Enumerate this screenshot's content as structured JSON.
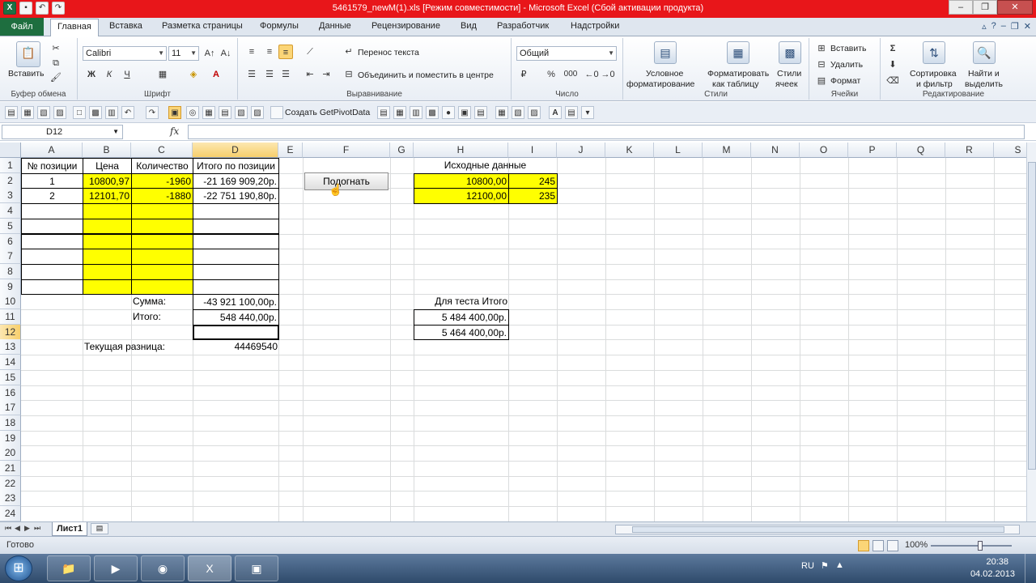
{
  "window": {
    "title": "5461579_newM(1).xls  [Режим совместимости]  -  Microsoft Excel (Сбой активации продукта)"
  },
  "ribbon_tabs": [
    "Файл",
    "Главная",
    "Вставка",
    "Разметка страницы",
    "Формулы",
    "Данные",
    "Рецензирование",
    "Вид",
    "Разработчик",
    "Надстройки"
  ],
  "active_tab": "Главная",
  "ribbon": {
    "clipboard": {
      "paste_label": "Вставить",
      "group_label": "Буфер обмена"
    },
    "font": {
      "font_name": "Calibri",
      "font_size": "11",
      "bold": "Ж",
      "italic": "К",
      "underline": "Ч",
      "group_label": "Шрифт"
    },
    "alignment": {
      "wrap_text": "Перенос текста",
      "merge_center": "Объединить и поместить в центре",
      "group_label": "Выравнивание"
    },
    "number": {
      "format": "Общий",
      "percent": "%",
      "thousands": "000",
      "group_label": "Число"
    },
    "styles": {
      "conditional": "Условное",
      "conditional2": "форматирование",
      "format_table": "Форматировать",
      "format_table2": "как таблицу",
      "cell_styles": "Стили",
      "cell_styles2": "ячеек",
      "group_label": "Стили"
    },
    "cells": {
      "insert": "Вставить",
      "delete": "Удалить",
      "format": "Формат",
      "group_label": "Ячейки"
    },
    "editing": {
      "sort": "Сортировка",
      "sort2": "и фильтр",
      "find": "Найти и",
      "find2": "выделить",
      "group_label": "Редактирование"
    }
  },
  "toolbar2": {
    "pivot_label": "Создать GetPivotData"
  },
  "formula_bar": {
    "name_box": "D12",
    "fx": "fx",
    "formula": ""
  },
  "columns": [
    "A",
    "B",
    "C",
    "D",
    "E",
    "F",
    "G",
    "H",
    "I",
    "J",
    "K",
    "L",
    "M",
    "N",
    "O",
    "P",
    "Q",
    "R",
    "S"
  ],
  "rows": [
    "1",
    "2",
    "3",
    "4",
    "5",
    "6",
    "7",
    "8",
    "9",
    "10",
    "11",
    "12",
    "13",
    "14",
    "15",
    "16",
    "17",
    "18",
    "19",
    "20",
    "21",
    "22",
    "23",
    "24"
  ],
  "cells": {
    "A1": "№  позиции",
    "B1": "Цена",
    "C1": "Количество",
    "D1": "Итого по позиции",
    "A2": "1",
    "B2": "10800,97",
    "C2": "-1960",
    "D2": "-21 169 909,20р.",
    "A3": "2",
    "B3": "12101,70",
    "C3": "-1880",
    "D3": "-22 751 190,80р.",
    "C10": "Сумма:",
    "D10": "-43 921 100,00р.",
    "C11": "Итого:",
    "D11": "548 440,00р.",
    "B13": "Текущая разница:",
    "D13": "44469540",
    "H1": "Исходные данные",
    "H2": "10800,00",
    "I2": "245",
    "H3": "12100,00",
    "I3": "235",
    "H10": "Для теста Итого",
    "H11": "5 484 400,00р.",
    "H12": "5 464 400,00р."
  },
  "macro_button": "Подогнать",
  "selected_cell": "D12",
  "sheet_tabs": [
    "Лист1"
  ],
  "status": {
    "text": "Готово",
    "zoom": "100%"
  },
  "taskbar": {
    "lang": "RU",
    "time": "20:38",
    "date": "04.02.2013"
  },
  "colors": {
    "highlight": "#ffff00",
    "title_bar": "#e8161a",
    "file_tab": "#1e6e3f"
  }
}
